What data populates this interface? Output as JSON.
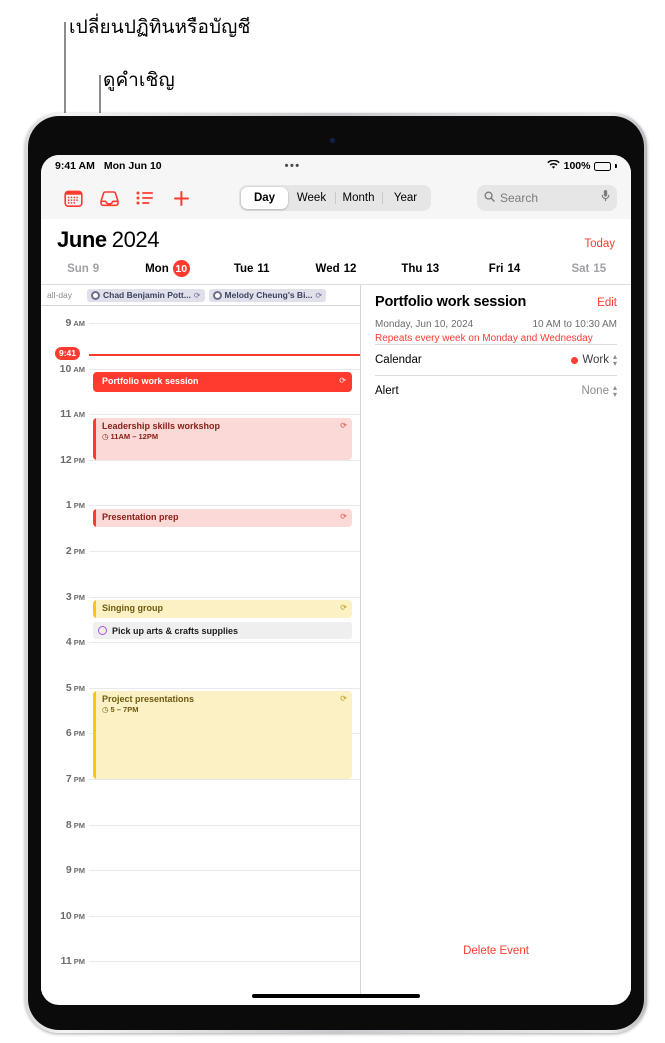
{
  "callouts": [
    {
      "text": "เปลี่ยนปฏิทินหรือบัญชี"
    },
    {
      "text": "ดูคำเชิญ"
    }
  ],
  "status_bar": {
    "time": "9:41 AM",
    "date": "Mon Jun 10",
    "dots": "•••",
    "battery_pct": "100%",
    "wifi_icon": "wifi-icon",
    "battery_icon": "battery-icon"
  },
  "toolbar": {
    "icons": [
      {
        "name": "calendars-icon",
        "label": "Calendars"
      },
      {
        "name": "inbox-icon",
        "label": "Inbox"
      },
      {
        "name": "list-icon",
        "label": "List"
      },
      {
        "name": "add-event-icon",
        "label": "Add"
      }
    ],
    "segments": [
      {
        "label": "Day",
        "active": true
      },
      {
        "label": "Week",
        "active": false
      },
      {
        "label": "Month",
        "active": false
      },
      {
        "label": "Year",
        "active": false
      }
    ],
    "search_placeholder": "Search",
    "search_icon": "search-icon",
    "mic_icon": "microphone-icon"
  },
  "header": {
    "month": "June",
    "year": "2024",
    "today_label": "Today"
  },
  "weekdays": [
    {
      "name": "Sun",
      "num": "9",
      "dim": true,
      "selected": false
    },
    {
      "name": "Mon",
      "num": "10",
      "dim": false,
      "selected": true
    },
    {
      "name": "Tue",
      "num": "11",
      "dim": false,
      "selected": false
    },
    {
      "name": "Wed",
      "num": "12",
      "dim": false,
      "selected": false
    },
    {
      "name": "Thu",
      "num": "13",
      "dim": false,
      "selected": false
    },
    {
      "name": "Fri",
      "num": "14",
      "dim": false,
      "selected": false
    },
    {
      "name": "Sat",
      "num": "15",
      "dim": true,
      "selected": false
    }
  ],
  "allday": {
    "label": "all-day",
    "events": [
      {
        "title": "Chad Benjamin Pott...",
        "repeat_icon": "repeat-icon"
      },
      {
        "title": "Melody Cheung's Bi...",
        "repeat_icon": "repeat-icon"
      }
    ]
  },
  "timeline": {
    "hours": [
      {
        "num": "9",
        "ampm": "AM"
      },
      {
        "num": "10",
        "ampm": "AM"
      },
      {
        "num": "11",
        "ampm": "AM"
      },
      {
        "num": "12",
        "ampm": "PM"
      },
      {
        "num": "1",
        "ampm": "PM"
      },
      {
        "num": "2",
        "ampm": "PM"
      },
      {
        "num": "3",
        "ampm": "PM"
      },
      {
        "num": "4",
        "ampm": "PM"
      },
      {
        "num": "5",
        "ampm": "PM"
      },
      {
        "num": "6",
        "ampm": "PM"
      },
      {
        "num": "7",
        "ampm": "PM"
      },
      {
        "num": "8",
        "ampm": "PM"
      },
      {
        "num": "9",
        "ampm": "PM"
      },
      {
        "num": "10",
        "ampm": "PM"
      },
      {
        "num": "11",
        "ampm": "PM"
      }
    ],
    "now_label": "9:41",
    "events": [
      {
        "title": "Portfolio work session",
        "time": "",
        "style": "selected",
        "repeat_icon": "repeat-icon"
      },
      {
        "title": "Leadership skills workshop",
        "time": "11AM – 12PM",
        "style": "red-soft",
        "repeat_icon": "repeat-icon",
        "clock_icon": "clock-icon"
      },
      {
        "title": "Presentation prep",
        "time": "",
        "style": "red-soft",
        "repeat_icon": "repeat-icon"
      },
      {
        "title": "Singing group",
        "time": "",
        "style": "yellow",
        "repeat_icon": "repeat-icon"
      },
      {
        "title": "Project presentations",
        "time": "5 – 7PM",
        "style": "yellow",
        "repeat_icon": "repeat-icon",
        "clock_icon": "clock-icon"
      }
    ],
    "reminder": {
      "title": "Pick up arts & crafts supplies",
      "circle_icon": "reminder-circle-icon"
    }
  },
  "detail": {
    "title": "Portfolio work session",
    "edit_label": "Edit",
    "date": "Monday, Jun 10, 2024",
    "time": "10 AM to 10:30 AM",
    "repeat": "Repeats every week on Monday and Wednesday",
    "rows": [
      {
        "label": "Calendar",
        "value": "Work",
        "has_dot": true,
        "muted": false
      },
      {
        "label": "Alert",
        "value": "None",
        "has_dot": false,
        "muted": true
      }
    ],
    "delete_label": "Delete Event"
  },
  "colors": {
    "accent_red": "#ff3b30",
    "yellow": "#f5c518",
    "purple": "#af52de",
    "allday_blue": "#6b6f8d"
  }
}
